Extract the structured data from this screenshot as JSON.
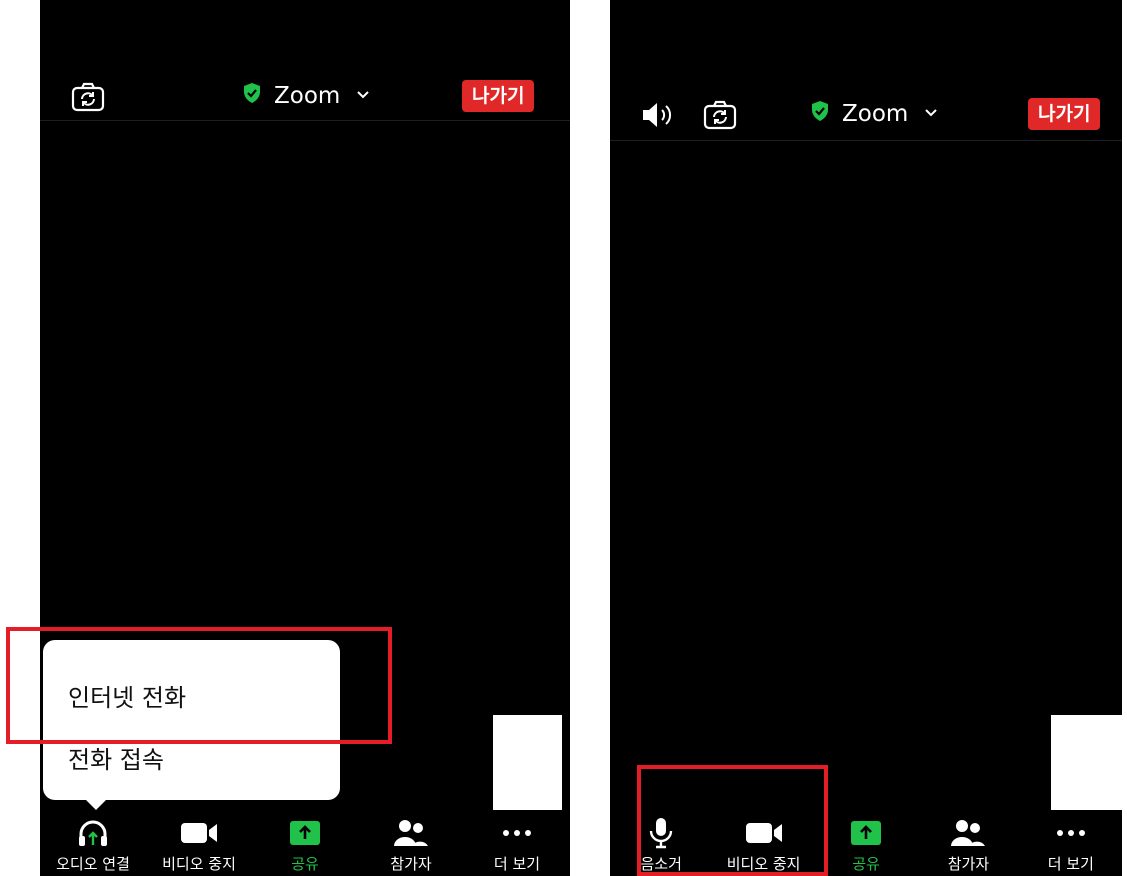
{
  "left_screen": {
    "header": {
      "title": "Zoom",
      "leave_label": "나가기"
    },
    "audio_popup": {
      "items": [
        "인터넷 전화",
        "전화 접속"
      ]
    },
    "toolbar": [
      {
        "label": "오디오 연결",
        "icon": "headphones-icon"
      },
      {
        "label": "비디오 중지",
        "icon": "video-camera-icon"
      },
      {
        "label": "공유",
        "icon": "share-arrow-icon"
      },
      {
        "label": "참가자",
        "icon": "participants-icon"
      },
      {
        "label": "더 보기",
        "icon": "more-dots-icon"
      }
    ]
  },
  "right_screen": {
    "header": {
      "title": "Zoom",
      "leave_label": "나가기"
    },
    "toolbar": [
      {
        "label": "음소거",
        "icon": "microphone-icon"
      },
      {
        "label": "비디오 중지",
        "icon": "video-camera-icon"
      },
      {
        "label": "공유",
        "icon": "share-arrow-icon"
      },
      {
        "label": "참가자",
        "icon": "participants-icon"
      },
      {
        "label": "더 보기",
        "icon": "more-dots-icon"
      }
    ]
  },
  "colors": {
    "accent_green": "#21c24a",
    "leave_red": "#e02828",
    "highlight_red": "#e41e26",
    "background": "#000000"
  }
}
